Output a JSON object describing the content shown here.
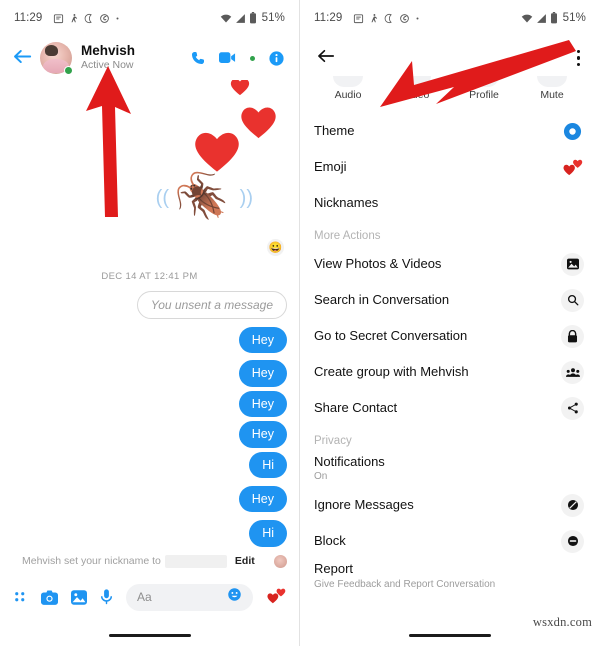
{
  "status_bar": {
    "time": "11:29",
    "left_icons": [
      "calendar-icon",
      "person-walking-icon",
      "moon-icon",
      "data-saver-icon",
      "dot-icon"
    ],
    "right_icons": [
      "wifi-icon",
      "signal-icon",
      "battery-icon"
    ],
    "battery": "51%"
  },
  "chat": {
    "header": {
      "back_icon": "back-arrow-icon",
      "name": "Mehvish",
      "status": "Active Now",
      "call_icon": "phone-icon",
      "video_icon": "video-camera-icon",
      "info_icon": "info-icon"
    },
    "sticker": {
      "hearts": "❤️",
      "bug": "🪳",
      "reaction": "😀"
    },
    "timestamp": "DEC 14 AT 12:41 PM",
    "unsent": "You unsent a message",
    "messages": [
      {
        "text": "Hey",
        "gap": false
      },
      {
        "text": "Hey",
        "gap": true
      },
      {
        "text": "Hey",
        "gap": false
      },
      {
        "text": "Hey",
        "gap": false
      },
      {
        "text": "Hi",
        "gap": false
      },
      {
        "text": "Hey",
        "gap": true
      },
      {
        "text": "Hi",
        "gap": true
      }
    ],
    "nickname_notice": {
      "prefix": "Mehvish set your nickname to",
      "redacted": "",
      "edit_label": "Edit"
    },
    "composer": {
      "apps_icon": "apps-grid-icon",
      "camera_icon": "camera-icon",
      "gallery_icon": "gallery-icon",
      "mic_icon": "microphone-icon",
      "placeholder": "Aa",
      "emoji_icon": "emoji-smiley-icon",
      "like_icon": "hearts-icon"
    }
  },
  "details": {
    "header": {
      "back_icon": "back-arrow-icon",
      "overflow_icon": "kebab-menu-icon"
    },
    "quick_actions": [
      {
        "label": "Audio",
        "icon": "phone-icon"
      },
      {
        "label": "Video",
        "icon": "video-camera-icon"
      },
      {
        "label": "Profile",
        "icon": "profile-icon"
      },
      {
        "label": "Mute",
        "icon": "mute-bell-icon"
      }
    ],
    "items": [
      {
        "label": "Theme",
        "sub": "",
        "icon": "theme-color-circle-icon",
        "type": "theme"
      },
      {
        "label": "Emoji",
        "sub": "",
        "icon": "hearts-emoji-icon",
        "type": "emoji"
      },
      {
        "label": "Nicknames",
        "sub": "",
        "icon": "",
        "type": "none"
      }
    ],
    "more_actions_header": "More Actions",
    "more_actions": [
      {
        "label": "View Photos & Videos",
        "sub": "",
        "icon": "photo-icon",
        "type": "circle"
      },
      {
        "label": "Search in Conversation",
        "sub": "",
        "icon": "search-icon",
        "type": "circle"
      },
      {
        "label": "Go to Secret Conversation",
        "sub": "",
        "icon": "lock-icon",
        "type": "circle"
      },
      {
        "label": "Create group with Mehvish",
        "sub": "",
        "icon": "group-people-icon",
        "type": "circle"
      },
      {
        "label": "Share Contact",
        "sub": "",
        "icon": "share-icon",
        "type": "circle"
      }
    ],
    "privacy_header": "Privacy",
    "privacy_items": [
      {
        "label": "Notifications",
        "sub": "On",
        "icon": "",
        "type": "none"
      },
      {
        "label": "Ignore Messages",
        "sub": "",
        "icon": "ignore-slash-icon",
        "type": "circle"
      },
      {
        "label": "Block",
        "sub": "",
        "icon": "block-icon",
        "type": "circle"
      },
      {
        "label": "Report",
        "sub": "Give Feedback and Report Conversation",
        "icon": "",
        "type": "none"
      }
    ]
  },
  "annotations": {
    "arrow_color": "#e01b1b",
    "left_arrow_target": "Mehvish",
    "right_arrow_target": "Block"
  },
  "watermark": "wsxdn.com",
  "colors": {
    "accent_blue": "#1f94f1",
    "online_green": "#31a24c",
    "arrow_red": "#e01b1b",
    "muted_text": "#9a9a9a"
  }
}
